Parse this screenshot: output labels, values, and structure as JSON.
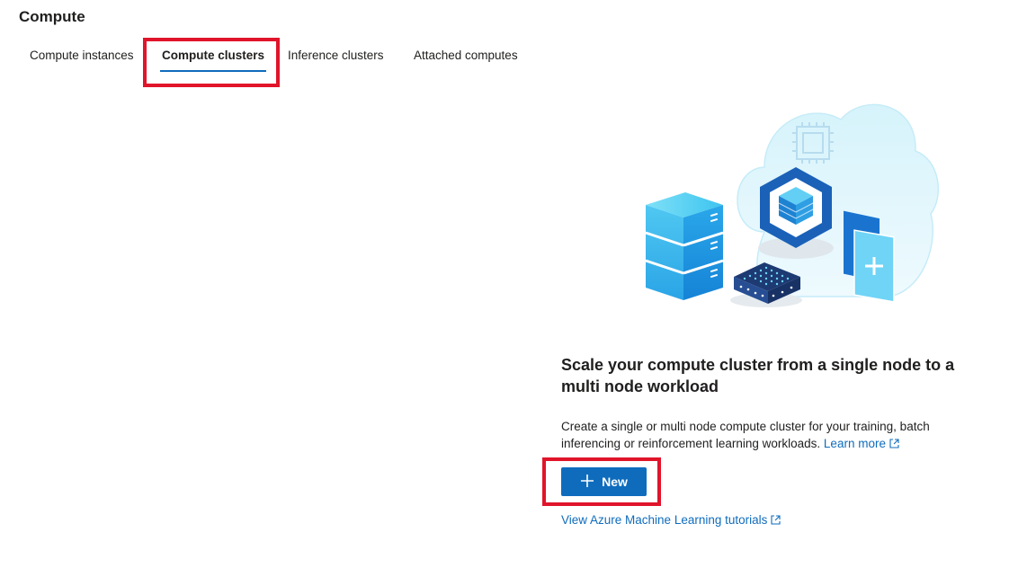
{
  "page": {
    "title": "Compute"
  },
  "tabs": [
    {
      "label": "Compute instances",
      "active": false
    },
    {
      "label": "Compute clusters",
      "active": true
    },
    {
      "label": "Inference clusters",
      "active": false
    },
    {
      "label": "Attached computes",
      "active": false
    }
  ],
  "empty_state": {
    "headline": "Scale your compute cluster from a single node to a multi node workload",
    "description": "Create a single or multi node compute cluster for your training, batch inferencing or reinforcement learning workloads.",
    "learn_more_label": "Learn more",
    "new_button_label": "New",
    "tutorials_link_label": "View Azure Machine Learning tutorials"
  },
  "icons": {
    "new_button": "plus-icon",
    "external_link": "external-link-icon",
    "illustration": "compute-cluster-illustration"
  },
  "colors": {
    "accent": "#0f6cbd",
    "highlight": "#e0142a",
    "text": "#201f1e"
  }
}
